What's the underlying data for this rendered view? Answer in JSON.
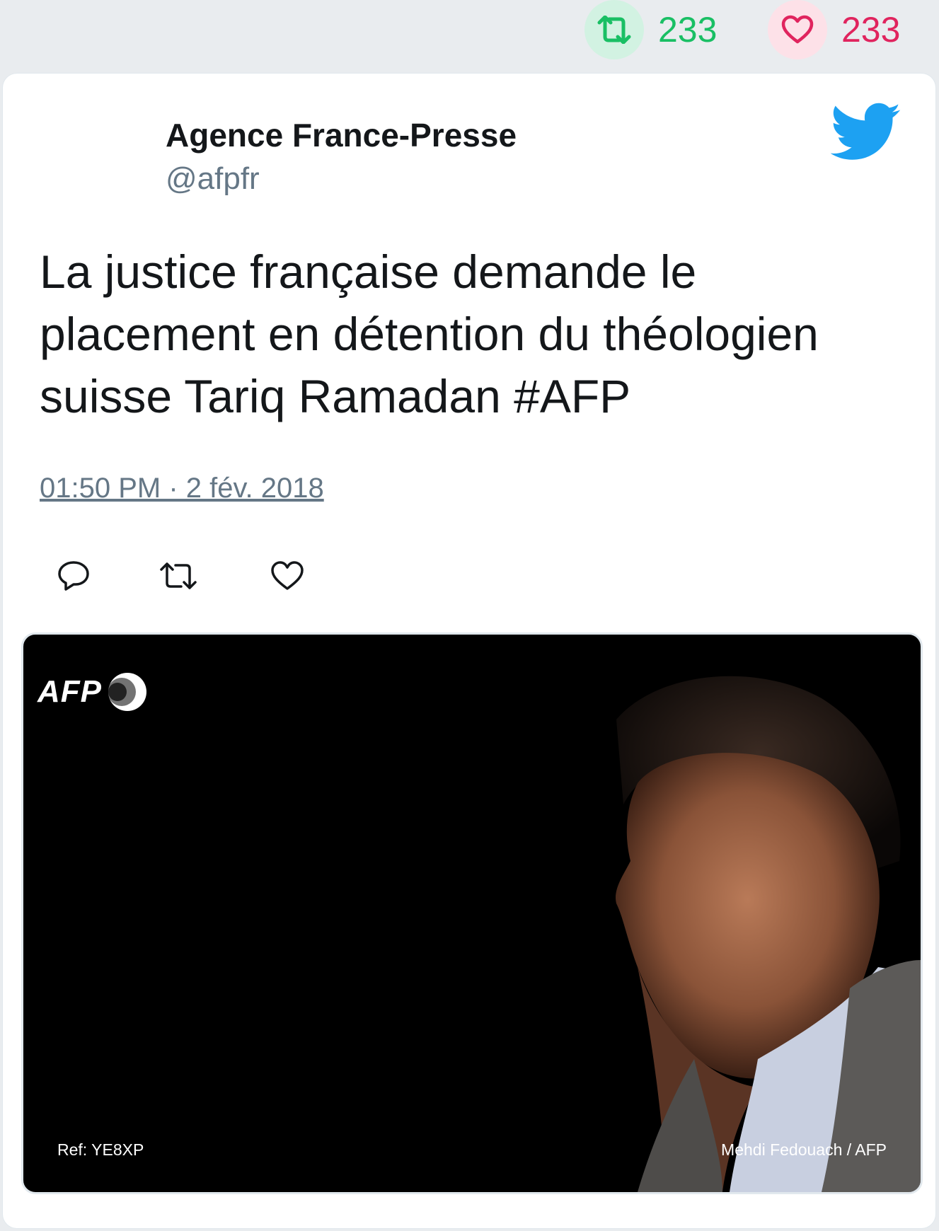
{
  "stats": {
    "retweets": "233",
    "likes": "233"
  },
  "tweet": {
    "author_name": "Agence France-Presse",
    "author_handle": "@afpfr",
    "text": "La justice française demande le placement en détention du théologien suisse Tariq Ramadan #AFP",
    "timestamp": "01:50 PM · 2 fév. 2018"
  },
  "media": {
    "logo_text": "AFP",
    "ref_text": "Ref: YE8XP",
    "credit_text": "Mehdi Fedouach / AFP"
  },
  "colors": {
    "retweet": "#19bf64",
    "like": "#e0245e",
    "twitter_blue": "#1da1f2"
  },
  "icons": {
    "retweet_stat": "retweet-icon",
    "like_stat": "heart-icon",
    "brand": "twitter-bird-icon",
    "reply_action": "reply-icon",
    "retweet_action": "retweet-icon",
    "like_action": "heart-icon"
  }
}
